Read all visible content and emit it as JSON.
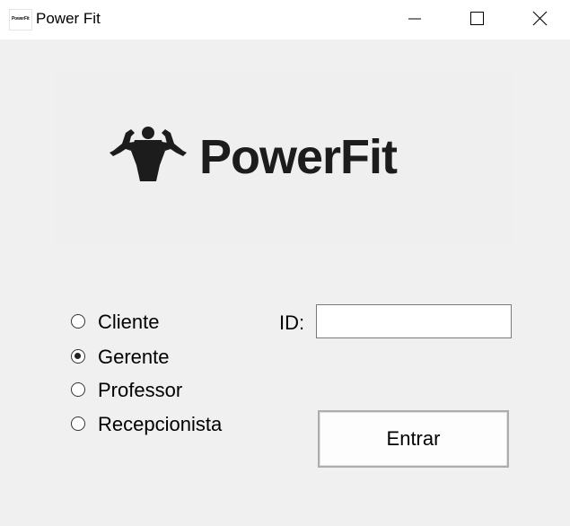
{
  "window": {
    "title": "Power Fit",
    "icon_text": "PowerFit",
    "controls": {
      "minimize": "minimize-icon",
      "maximize": "maximize-icon",
      "close": "close-icon"
    }
  },
  "logo": {
    "brand_text": "PowerFit",
    "icon": "bodybuilder-icon"
  },
  "role_options": [
    {
      "label": "Cliente",
      "selected": false
    },
    {
      "label": "Gerente",
      "selected": true
    },
    {
      "label": "Professor",
      "selected": false
    },
    {
      "label": "Recepcionista",
      "selected": false
    }
  ],
  "login": {
    "id_label": "ID:",
    "id_value": "",
    "submit_label": "Entrar"
  }
}
